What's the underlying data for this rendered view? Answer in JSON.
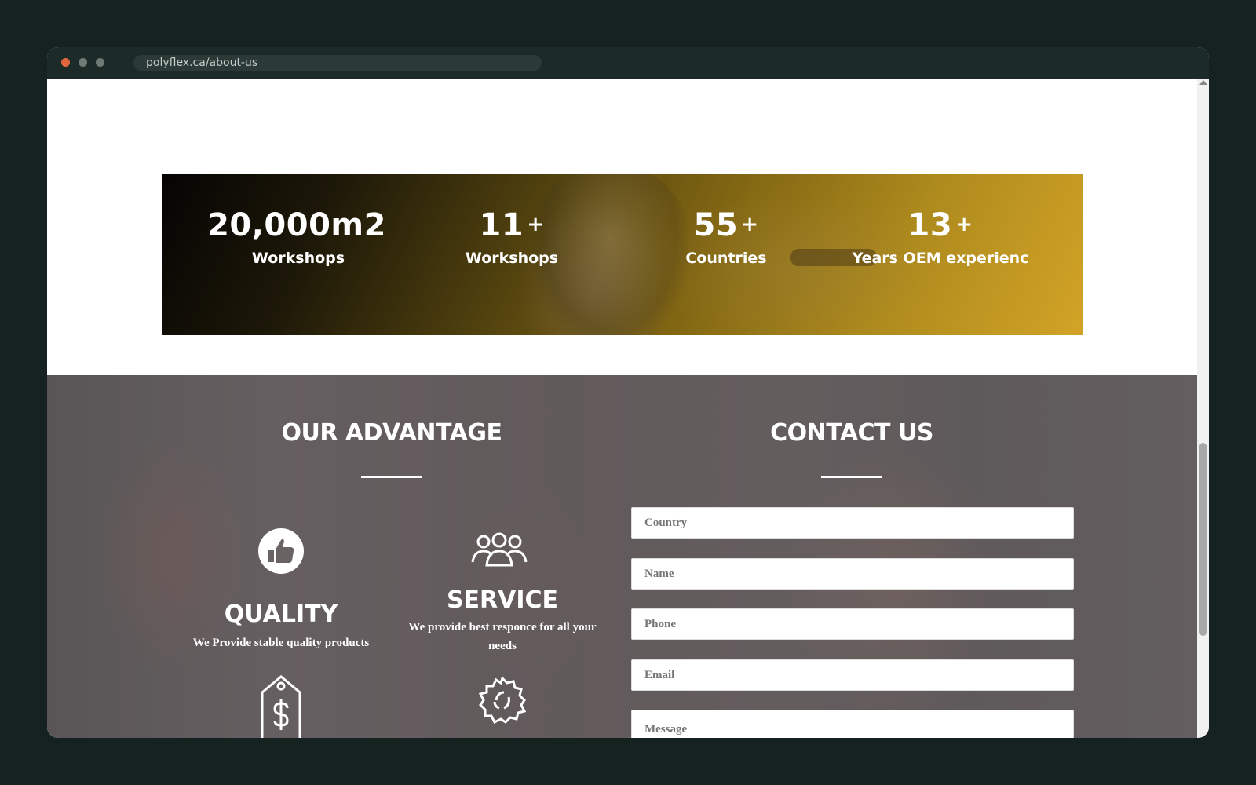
{
  "browser": {
    "url": "polyflex.ca/about-us"
  },
  "stats": [
    {
      "number": "20,000m2",
      "plus": "",
      "label": "Workshops"
    },
    {
      "number": "11",
      "plus": "+",
      "label": "Workshops"
    },
    {
      "number": "55",
      "plus": "+",
      "label": "Countries"
    },
    {
      "number": "13",
      "plus": "+",
      "label": "Years OEM experienc"
    }
  ],
  "advantage": {
    "title": "OUR ADVANTAGE",
    "items": [
      {
        "title": "QUALITY",
        "text": "We Provide stable quality products",
        "icon": "thumbs-up-icon"
      },
      {
        "title": "SERVICE",
        "text": "We provide best responce for all your needs",
        "icon": "team-icon"
      },
      {
        "title": "",
        "text": "",
        "icon": "price-tag-icon"
      },
      {
        "title": "",
        "text": "",
        "icon": "recycle-badge-icon"
      }
    ]
  },
  "contact": {
    "title": "CONTACT US",
    "fields": {
      "country": "Country",
      "name": "Name",
      "phone": "Phone",
      "email": "Email",
      "message": "Message"
    }
  },
  "colors": {
    "page_bg": "#16221f",
    "stats_gold": "#d2a326",
    "stats_dark": "#050403",
    "section_overlay": "#6a6364"
  }
}
